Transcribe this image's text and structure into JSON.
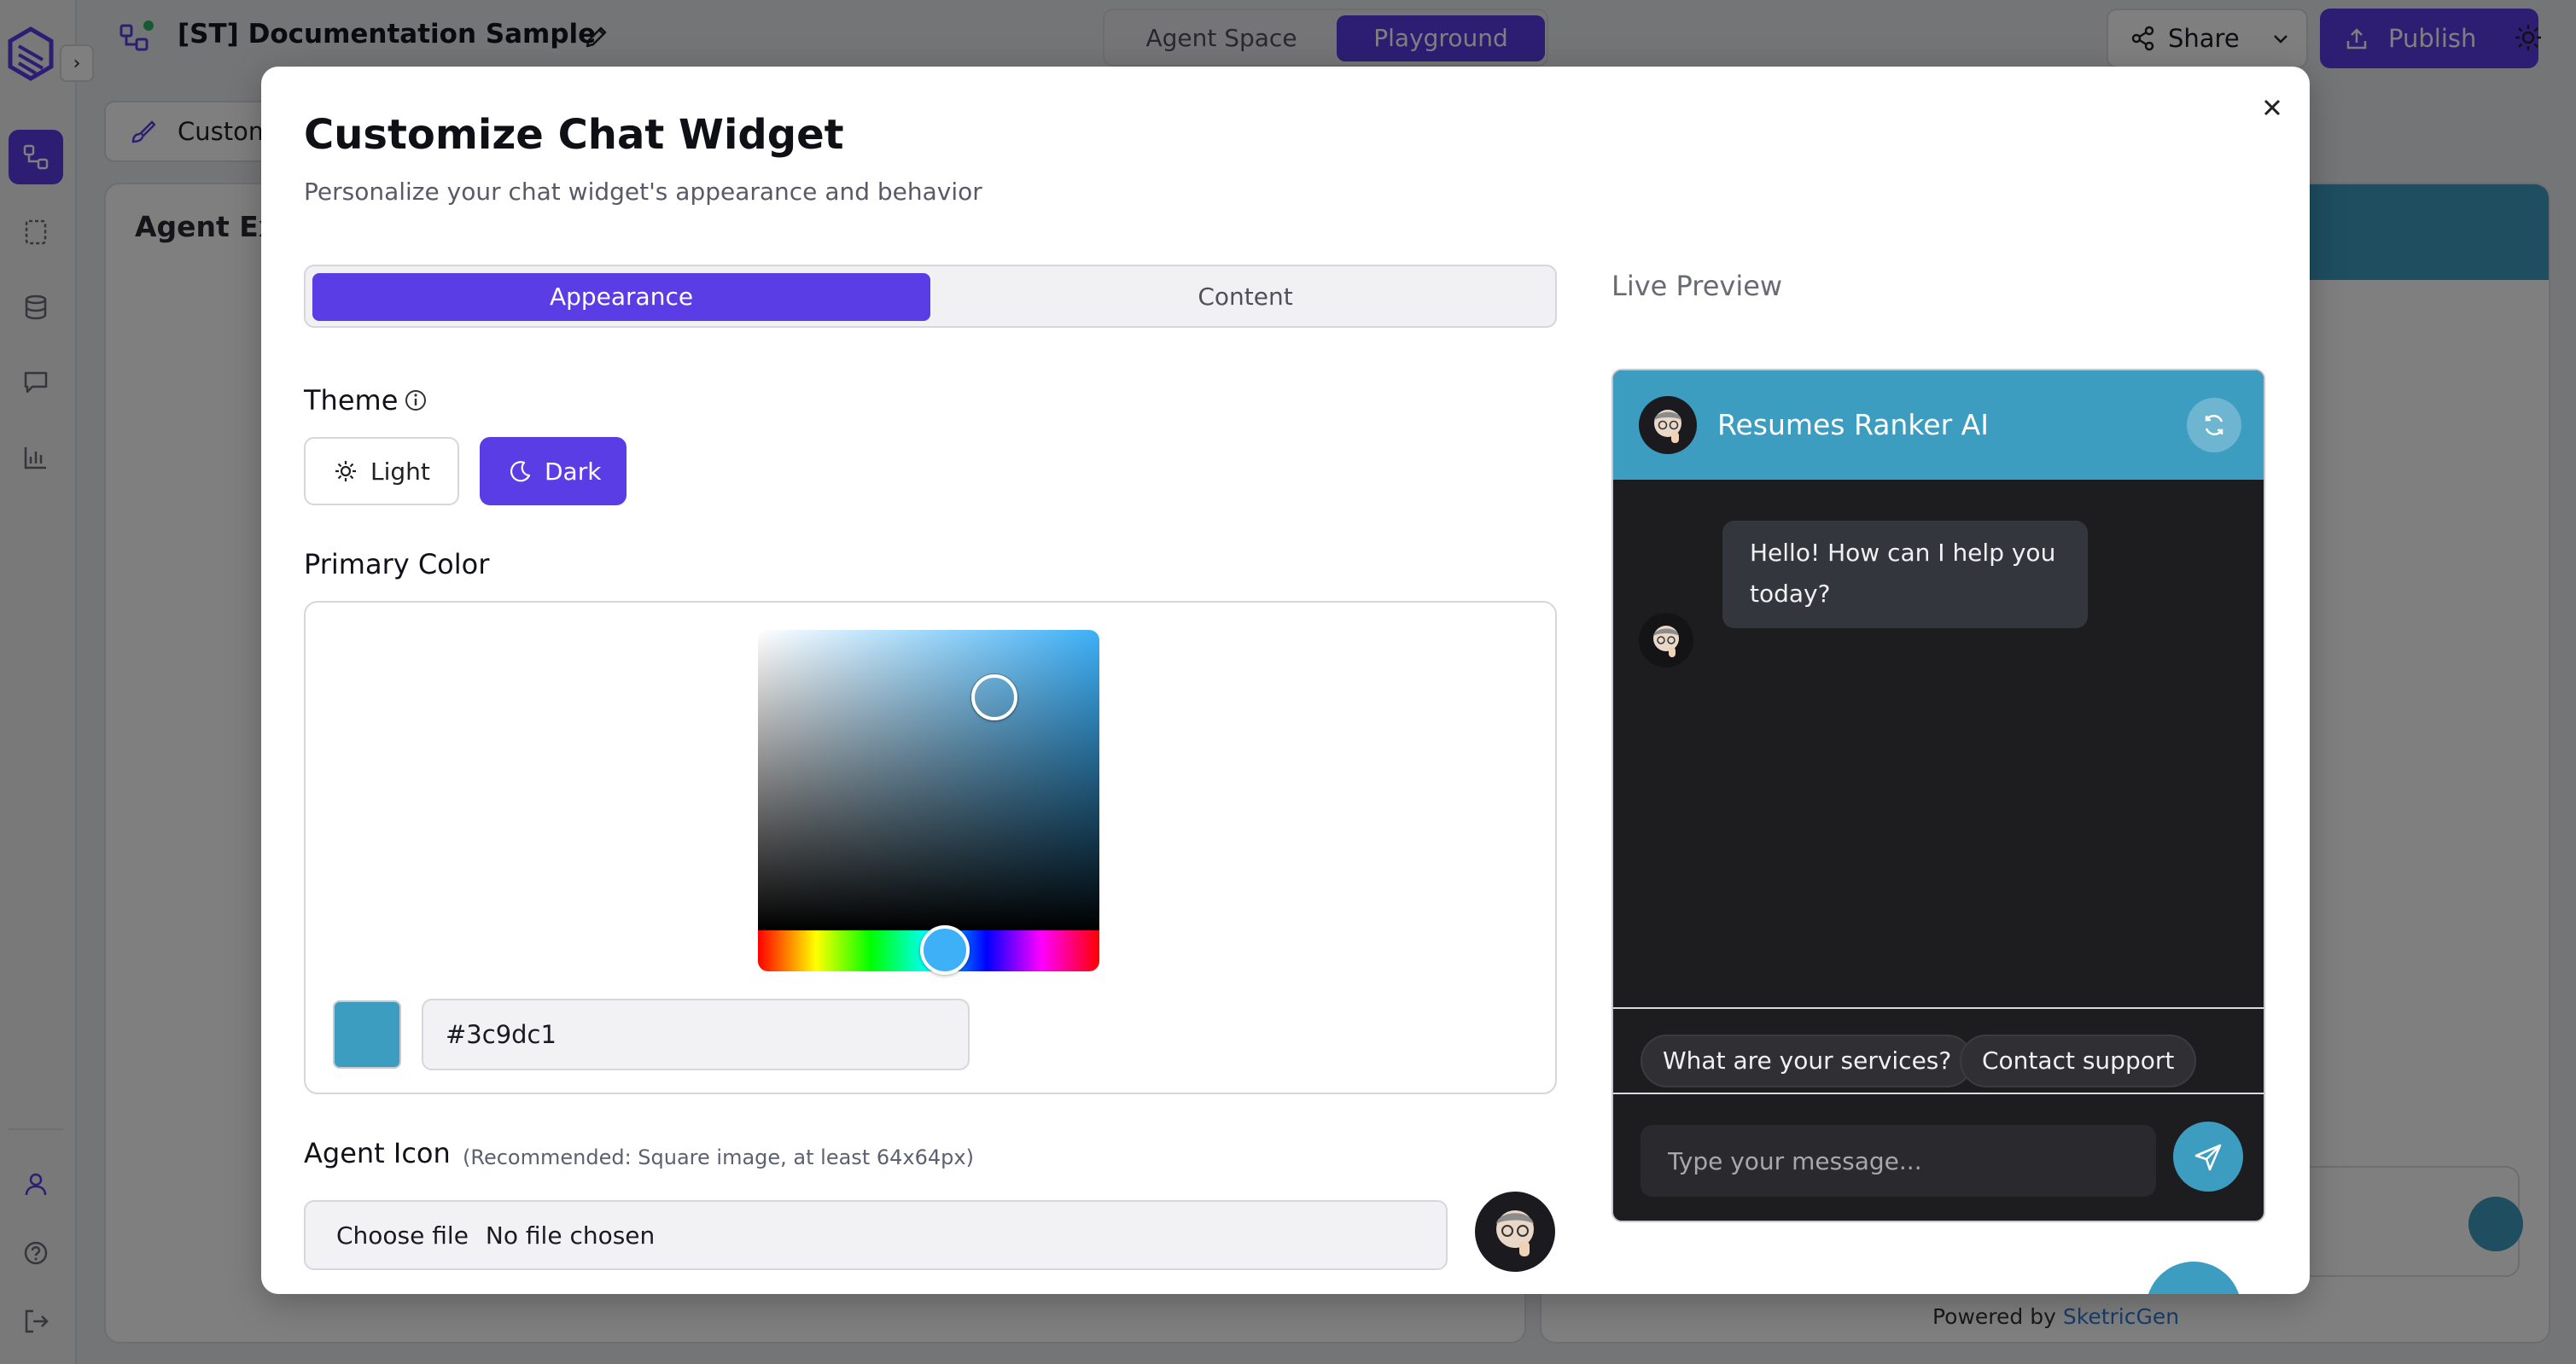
{
  "app": {
    "project_title": "[ST] Documentation Sample",
    "modes": {
      "agent_space": "Agent Space",
      "playground": "Playground"
    },
    "share_label": "Share",
    "publish_label": "Publish",
    "custom_tab_label": "Custom",
    "panel_title": "Agent Exe",
    "powered_prefix": "Powered by",
    "powered_brand": "SketricGen"
  },
  "modal": {
    "title": "Customize Chat Widget",
    "subtitle": "Personalize your chat widget's appearance and behavior",
    "tabs": {
      "appearance": "Appearance",
      "content": "Content"
    },
    "theme": {
      "label": "Theme",
      "light": "Light",
      "dark": "Dark",
      "selected": "Dark"
    },
    "primary_color": {
      "label": "Primary Color",
      "hex_value": "#3c9dc1"
    },
    "agent_icon": {
      "label": "Agent Icon",
      "hint": "(Recommended: Square image, at least 64x64px)",
      "choose_file": "Choose file",
      "file_status": "No file chosen"
    }
  },
  "preview": {
    "label": "Live Preview",
    "agent_name": "Resumes Ranker AI",
    "greeting": "Hello! How can I help you today?",
    "quick_replies": [
      "What are your services?",
      "Contact support"
    ],
    "input_placeholder": "Type your message..."
  },
  "colors": {
    "accent": "#5b3de6",
    "primary": "#3c9dc1",
    "preview_bg": "#1d1d1f"
  }
}
